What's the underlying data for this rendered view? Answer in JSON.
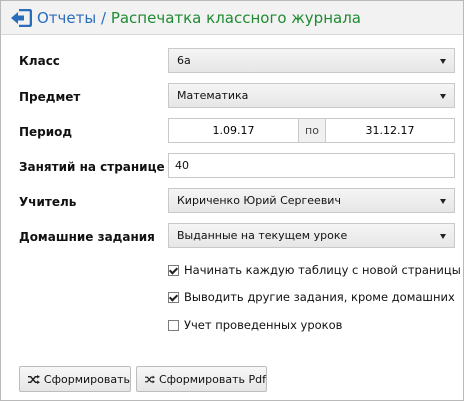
{
  "header": {
    "breadcrumb_parent": "Отчеты",
    "separator": " / ",
    "current": "Распечатка классного журнала"
  },
  "form": {
    "class": {
      "label": "Класс",
      "value": "6а"
    },
    "subject": {
      "label": "Предмет",
      "value": "Математика"
    },
    "period": {
      "label": "Период",
      "from": "1.09.17",
      "separator": "по",
      "to": "31.12.17"
    },
    "lessons_per_page": {
      "label": "Занятий на странице",
      "value": "40"
    },
    "teacher": {
      "label": "Учитель",
      "value": "Кириченко Юрий Сергеевич"
    },
    "homework": {
      "label": "Домашние задания",
      "value": "Выданные на текущем уроке"
    }
  },
  "options": [
    {
      "label": "Начинать каждую таблицу с новой страницы",
      "checked": true
    },
    {
      "label": "Выводить другие задания, кроме домашних",
      "checked": true
    },
    {
      "label": "Учет проведенных уроков",
      "checked": false
    }
  ],
  "buttons": {
    "generate": "Сформировать",
    "generate_pdf": "Сформировать Pdf"
  },
  "colors": {
    "link": "#2a6ebb",
    "current": "#1f8a32"
  }
}
